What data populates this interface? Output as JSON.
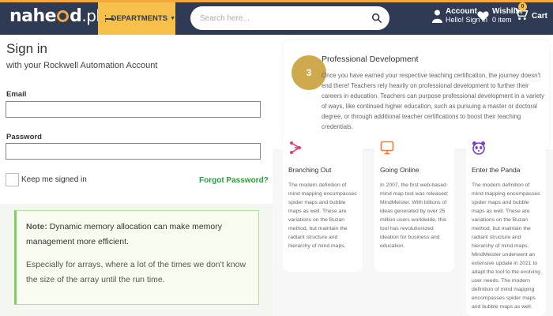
{
  "header": {
    "logo_text_a": "nahe",
    "logo_text_b": "d",
    "logo_text_c": ".pk",
    "departments_label": "DEPARTMENTS",
    "search_placeholder": "Search here...",
    "account_title": "Account",
    "account_sub": "Hello! Sign in",
    "wishlist_title": "Wishlist",
    "wishlist_sub": "0 item",
    "cart_label": "Cart",
    "cart_count": "0",
    "colors": {
      "bar": "#2f3a54",
      "accent": "#f6c04b",
      "topline": "#f2a83a"
    }
  },
  "signin": {
    "title": "Sign in",
    "subtitle": "with your Rockwell Automation Account",
    "email_label": "Email",
    "email_value": "",
    "password_label": "Password",
    "password_value": "",
    "keep_signed_in": "Keep me signed in",
    "keep_checked": false,
    "forgot": "Forgot Password?"
  },
  "note": {
    "label": "Note:",
    "line1": "Dynamic memory allocation can make memory management more efficient.",
    "line2": "Especially for arrays, where a lot of the times we don't know the size of the array until the run time."
  },
  "professional": {
    "number": "3",
    "title": "Professional Development",
    "body": "Once you have earned your respective teaching certification, the journey doesn't end there! Teachers rely heavily on professional development to further their careers in education. Teachers can purpose professional development in a variety of ways, like continued higher education, such as pursuing a master or doctoral degree, or through additional teacher certifications to boost their teaching credentials."
  },
  "cards": [
    {
      "icon": "branching-icon",
      "title": "Branching Out",
      "body": "The modern definition of mind mapping encompasses spider maps and bubble maps as well. These are variations on the Buzan method, but maintain the radiant structure and hierarchy of mind maps."
    },
    {
      "icon": "monitor-icon",
      "title": "Going Online",
      "body": "In 2007, the first web-based mind map tool was released: MindMeister. With billions of ideas generated by over 25 million users worldwide, this tool has revolutionized ideation for business and education."
    },
    {
      "icon": "panda-icon",
      "title": "Enter the Panda",
      "body": "The modern definition of mind mapping encompasses spider maps and bubble maps as well. These are variations on the Buzan method, but maintain the radiant structure and hierarchy of mind maps. MindMeister underwent an extensive update in 2021 to adapt the tool to the evolving user needs. The modern definition of mind mapping encompasses spider maps and bubble maps as well."
    }
  ]
}
